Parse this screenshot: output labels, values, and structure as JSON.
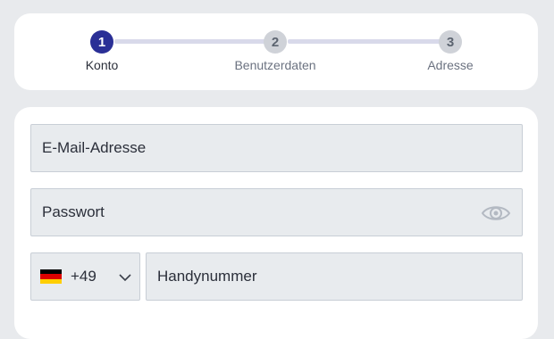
{
  "stepper": {
    "steps": [
      {
        "number": "1",
        "label": "Konto",
        "state": "active"
      },
      {
        "number": "2",
        "label": "Benutzerdaten",
        "state": "inactive"
      },
      {
        "number": "3",
        "label": "Adresse",
        "state": "inactive"
      }
    ]
  },
  "form": {
    "email": {
      "placeholder": "E-Mail-Adresse",
      "value": ""
    },
    "password": {
      "placeholder": "Passwort",
      "value": "",
      "toggle_icon": "eye-icon"
    },
    "phone": {
      "country_flag": "germany-flag",
      "country_code": "+49",
      "dropdown_icon": "chevron-down-icon",
      "placeholder": "Handynummer",
      "value": ""
    }
  },
  "colors": {
    "active_step": "#2a2f96",
    "inactive_step": "#cfd2d8",
    "track": "#d8d9ea",
    "field_bg": "#e8ebee",
    "page_bg": "#e8eaed"
  }
}
